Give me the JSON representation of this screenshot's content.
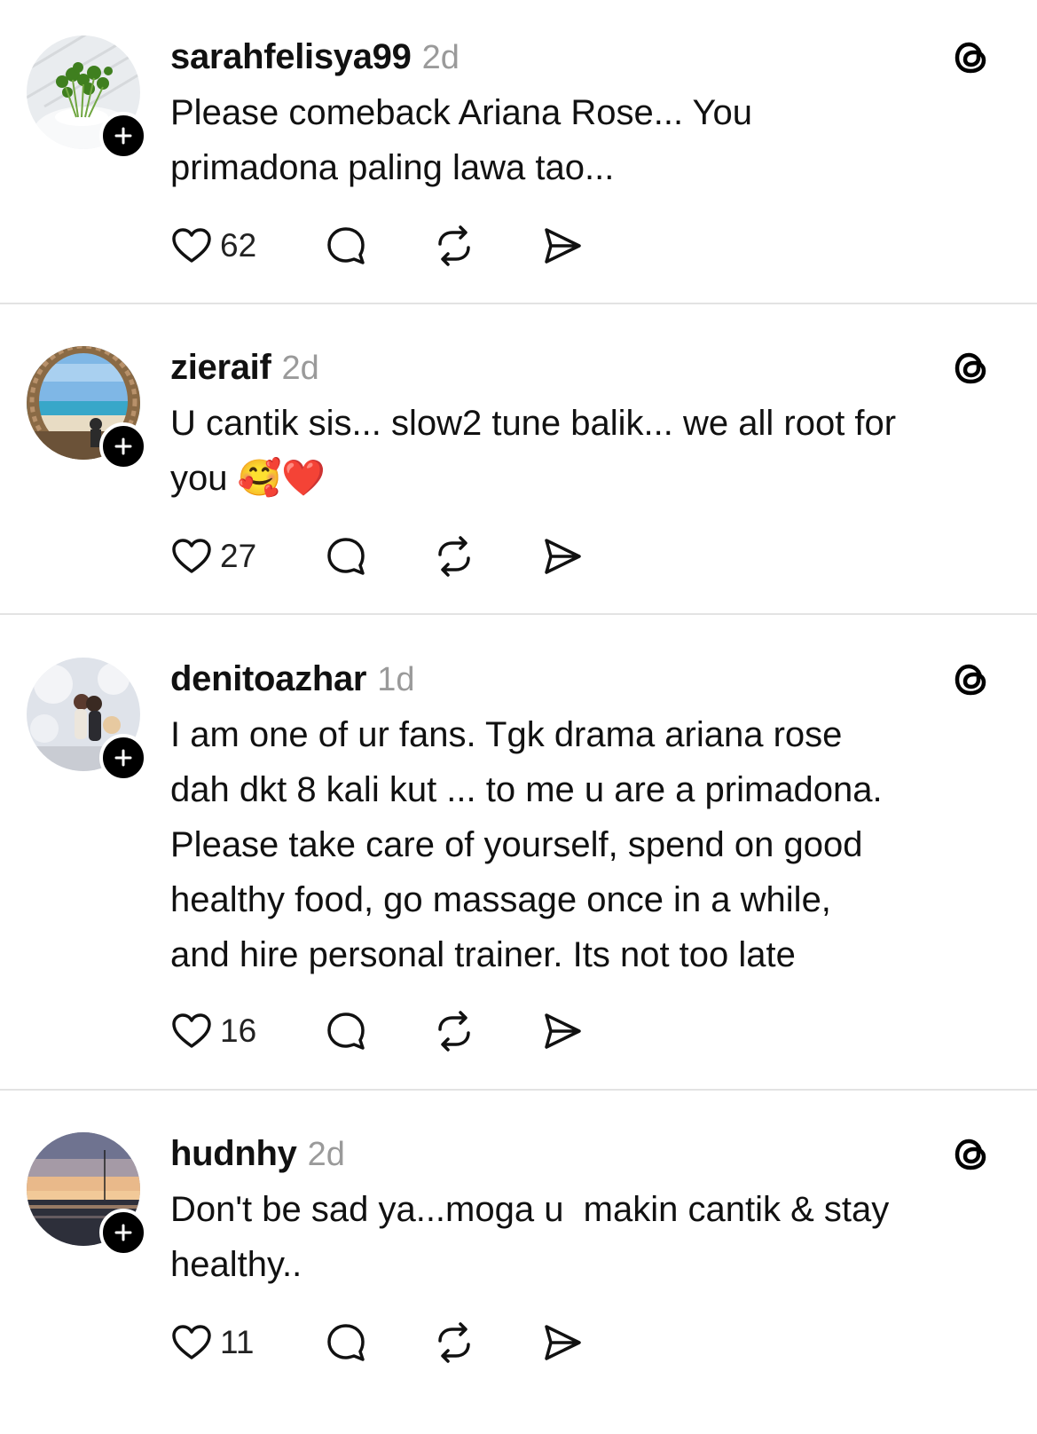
{
  "posts": [
    {
      "username": "sarahfelisya99",
      "time": "2d",
      "text": "Please comeback Ariana Rose... You\nprimadona paling lawa tao...",
      "likes": "62",
      "avatar": "plant-photo"
    },
    {
      "username": "zieraif",
      "time": "2d",
      "text": "U cantik sis... slow2 tune balik... we all root for\nyou 🥰❤️",
      "likes": "27",
      "avatar": "beach-photo"
    },
    {
      "username": "denitoazhar",
      "time": "1d",
      "text": "I am one of ur fans. Tgk drama ariana rose\ndah dkt 8 kali kut ... to me u are a primadona.\nPlease take care of yourself, spend on good\nhealthy food, go massage once in a while,\nand hire personal trainer. Its not too late",
      "likes": "16",
      "avatar": "wedding-photo"
    },
    {
      "username": "hudnhy",
      "time": "2d",
      "text": "Don't be sad ya...moga u  makin cantik & stay\nhealthy..",
      "likes": "11",
      "avatar": "sunset-photo"
    }
  ],
  "icons": {
    "like": "heart-icon",
    "reply": "comment-bubble-icon",
    "repost": "repost-icon",
    "share": "share-send-icon",
    "brand": "threads-logo-icon",
    "follow": "plus-icon"
  },
  "colors": {
    "text": "#111111",
    "timestamp": "#9a9a9a",
    "divider": "#e3e3e3",
    "badge": "#000000"
  }
}
